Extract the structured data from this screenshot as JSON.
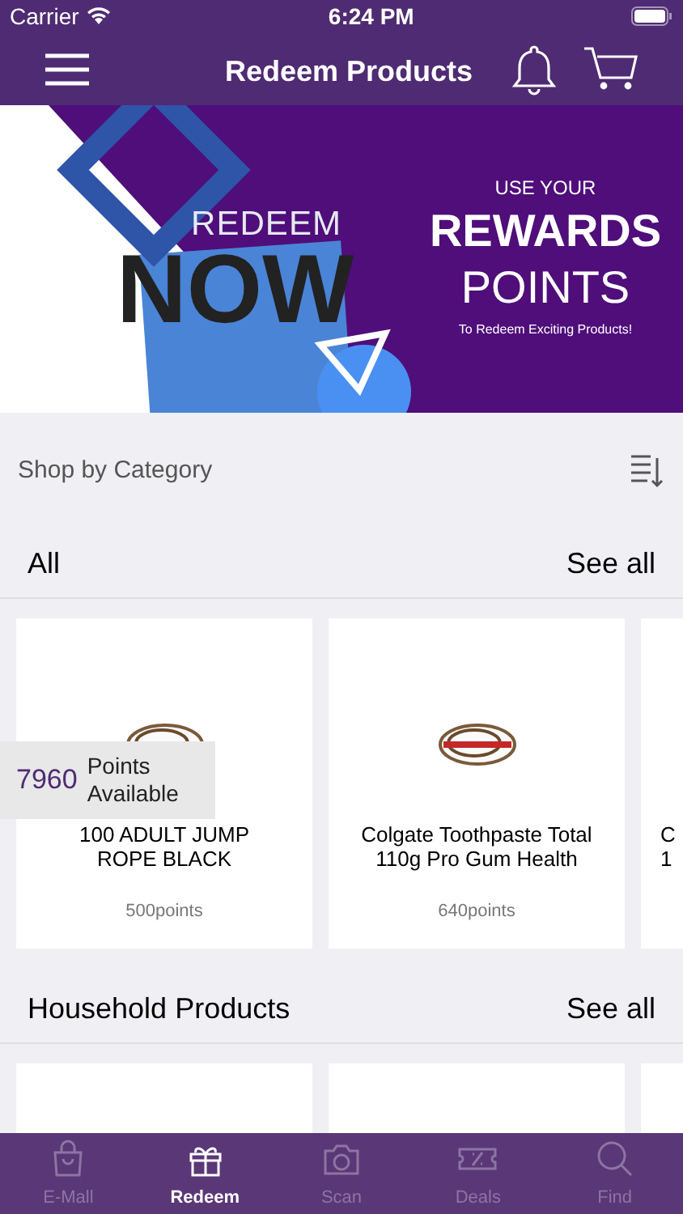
{
  "status_bar": {
    "carrier": "Carrier",
    "time": "6:24 PM"
  },
  "nav": {
    "title": "Redeem Products"
  },
  "banner": {
    "headline_small": "REDEEM",
    "headline_big": "NOW",
    "kicker": "USE YOUR",
    "title_bold": "REWARDS",
    "title_light": "POINTS",
    "tagline": "To Redeem Exciting Products!"
  },
  "category_bar": {
    "label": "Shop by Category"
  },
  "sections": [
    {
      "title": "All",
      "link": "See all",
      "products": [
        {
          "name_lines": [
            "100 ADULT JUMP",
            "ROPE BLACK"
          ],
          "points": "500points",
          "kind": "picture"
        },
        {
          "name_lines": [
            "Colgate Toothpaste Total",
            "110g Pro Gum Health"
          ],
          "points": "640points",
          "kind": "picture"
        },
        {
          "name_lines": [
            "C",
            "1"
          ],
          "kind": "text"
        }
      ]
    },
    {
      "title": "Household Products",
      "link": "See all",
      "products": [
        {
          "kind": "blank"
        },
        {
          "kind": "blank"
        },
        {
          "kind": "blank"
        }
      ]
    }
  ],
  "points_badge": {
    "value": "7960",
    "label_lines": [
      "Points",
      "Available"
    ]
  },
  "tabs": [
    {
      "label": "E-Mall",
      "selected": false
    },
    {
      "label": "Redeem",
      "selected": true
    },
    {
      "label": "Scan",
      "selected": false
    },
    {
      "label": "Deals",
      "selected": false
    },
    {
      "label": "Find",
      "selected": false
    }
  ]
}
